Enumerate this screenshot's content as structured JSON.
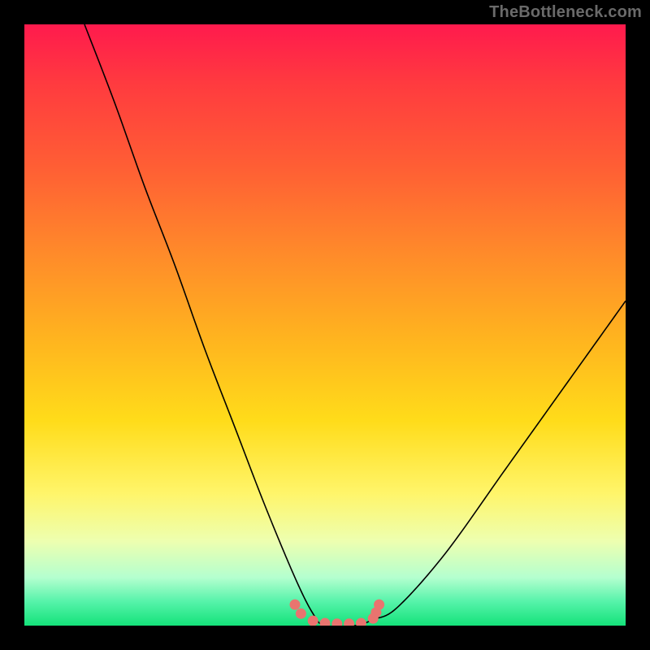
{
  "attribution": "TheBottleneck.com",
  "chart_data": {
    "type": "line",
    "title": "",
    "xlabel": "",
    "ylabel": "",
    "xlim": [
      0,
      100
    ],
    "ylim": [
      0,
      100
    ],
    "series": [
      {
        "name": "bottleneck-curve",
        "x": [
          10,
          15,
          20,
          25,
          30,
          35,
          40,
          45,
          48,
          50,
          55,
          58,
          62,
          70,
          80,
          90,
          100
        ],
        "values": [
          100,
          87,
          73,
          60,
          46,
          33,
          20,
          8,
          2,
          0,
          0,
          1,
          3,
          12,
          26,
          40,
          54
        ]
      }
    ],
    "markers": {
      "name": "highlight-points",
      "x": [
        45,
        46,
        48,
        50,
        52,
        54,
        56,
        58,
        58.5,
        59
      ],
      "values": [
        3.5,
        2.0,
        0.8,
        0.4,
        0.3,
        0.3,
        0.4,
        1.2,
        2.2,
        3.5
      ]
    }
  },
  "colors": {
    "curve": "#000000",
    "marker": "#e9746f",
    "background_top": "#ff1a4d",
    "background_bottom": "#14e27a",
    "frame": "#000000"
  }
}
